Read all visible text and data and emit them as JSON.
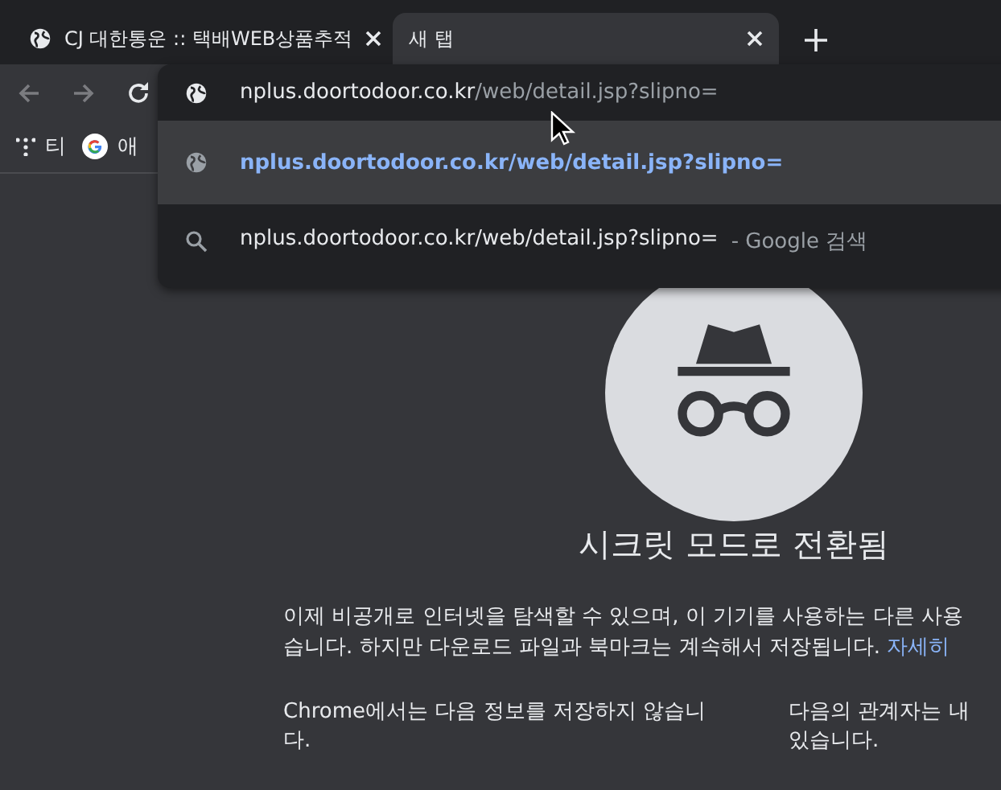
{
  "tabs": [
    {
      "title": "CJ 대한통운 :: 택배WEB상품추적",
      "selected": false
    },
    {
      "title": "새 탭",
      "selected": true
    }
  ],
  "omnibox": {
    "host": "nplus.doortodoor.co.kr",
    "path": "/web/detail.jsp?slipno="
  },
  "suggestions": [
    {
      "kind": "url",
      "text": "nplus.doortodoor.co.kr/web/detail.jsp?slipno=",
      "selected": true
    },
    {
      "kind": "search",
      "text": "nplus.doortodoor.co.kr/web/detail.jsp?slipno=",
      "suffix": "- Google 검색",
      "selected": false
    }
  ],
  "bookmarks": [
    {
      "kind": "dots",
      "label": "티"
    },
    {
      "kind": "google",
      "label": "애"
    }
  ],
  "page": {
    "heading": "시크릿 모드로 전환됨",
    "intro_lines": [
      "이제 비공개로 인터넷을 탐색할 수 있으며, 이 기기를 사용하는 다른 사용",
      "습니다. 하지만 다운로드 파일과 북마크는 계속해서 저장됩니다."
    ],
    "learn_more": "자세히",
    "columns": [
      {
        "lines": [
          "Chrome에서는 다음 정보를 저장하지 않습니",
          "다."
        ]
      },
      {
        "lines": [
          "다음의 관계자는 내",
          "있습니다."
        ]
      }
    ]
  }
}
